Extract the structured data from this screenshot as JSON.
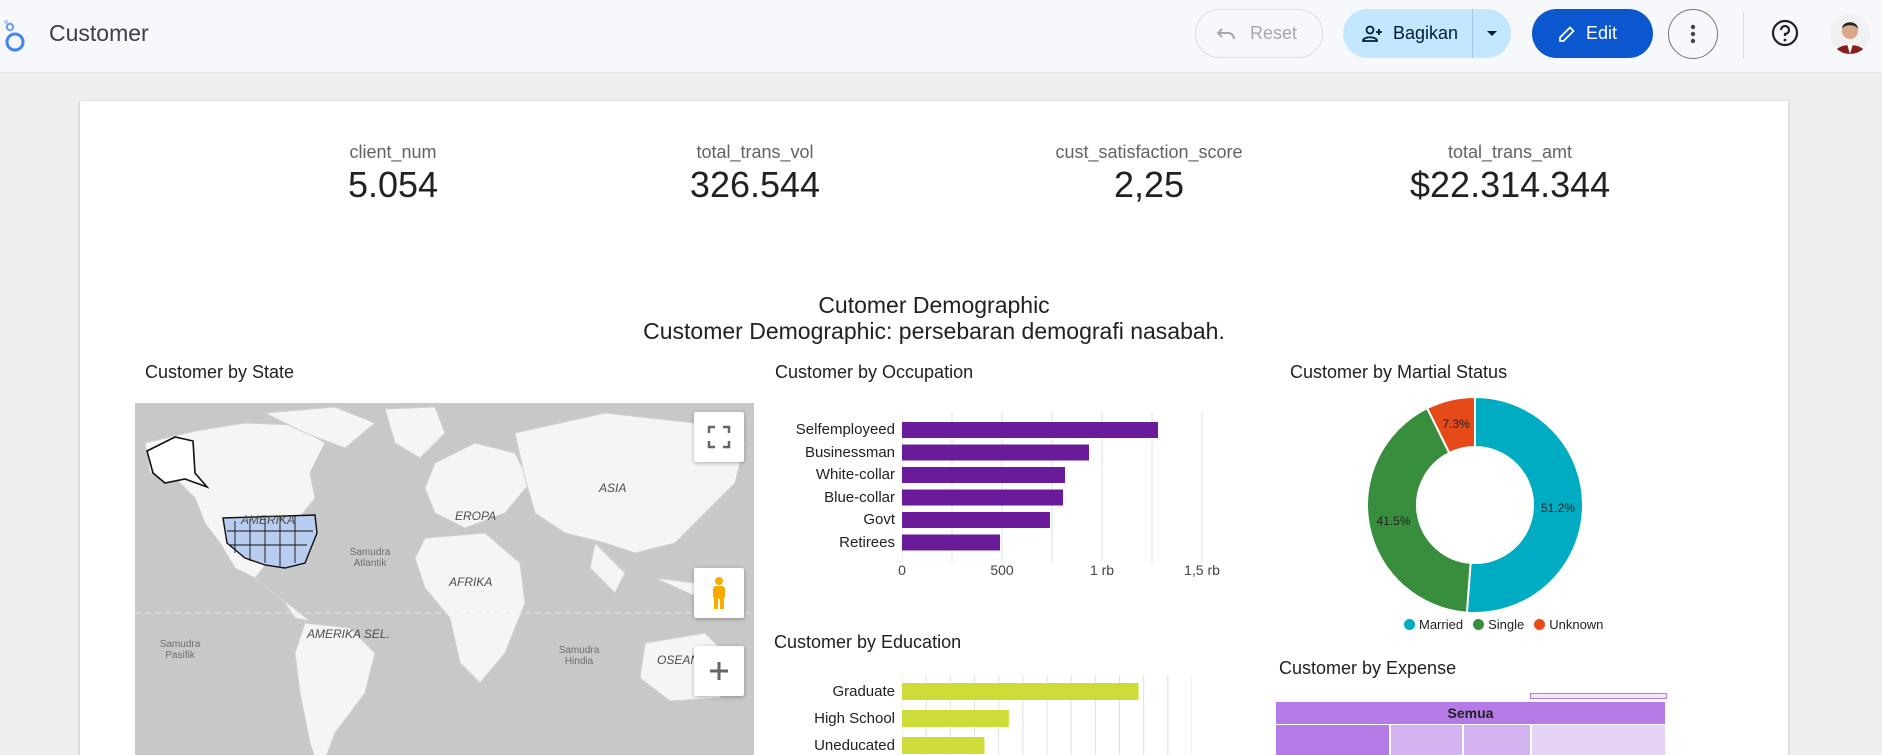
{
  "header": {
    "title": "Customer",
    "reset_label": "Reset",
    "share_label": "Bagikan",
    "edit_label": "Edit"
  },
  "kpis": [
    {
      "label": "client_num",
      "value": "5.054"
    },
    {
      "label": "total_trans_vol",
      "value": "326.544"
    },
    {
      "label": "cust_satisfaction_score",
      "value": "2,25"
    },
    {
      "label": "total_trans_amt",
      "value": "$22.314.344"
    }
  ],
  "section": {
    "title": "Cutomer Demographic",
    "subtitle": "Customer Demographic: persebaran demografi nasabah."
  },
  "map": {
    "title": "Customer by State",
    "labels": {
      "america": "AMERIKA",
      "europe": "EROPA",
      "asia": "ASIA",
      "africa": "AFRIKA",
      "south_america": "AMERIKA SEL.",
      "oceania": "OSEANIA",
      "atlantic": "Samudra Atlantik",
      "pacific": "Samudra Pasifik",
      "indian": "Samudra Hindia"
    }
  },
  "colors": {
    "bar_occupation": "#6a1b9a",
    "bar_education": "#cddc39",
    "married": "#00acc1",
    "single": "#388e3c",
    "unknown": "#e64a19",
    "primary": "#0b57d0"
  },
  "chart_data": [
    {
      "type": "bar",
      "orientation": "horizontal",
      "title": "Customer by Occupation",
      "categories": [
        "Selfemployeed",
        "Businessman",
        "White-collar",
        "Blue-collar",
        "Govt",
        "Retirees"
      ],
      "values": [
        1280,
        935,
        815,
        805,
        740,
        490
      ],
      "xlim": [
        0,
        1500
      ],
      "xticks": [
        "0",
        "500",
        "1 rb",
        "1,5 rb"
      ]
    },
    {
      "type": "pie",
      "title": "Customer by Martial Status",
      "labels": [
        "Married",
        "Single",
        "Unknown"
      ],
      "values": [
        51.2,
        41.5,
        7.3
      ],
      "value_labels": [
        "51.2%",
        "41.5%",
        "7.3%"
      ],
      "legend_position": "bottom"
    },
    {
      "type": "bar",
      "orientation": "horizontal",
      "title": "Customer by Education",
      "categories": [
        "Graduate",
        "High School",
        "Uneducated"
      ],
      "values": [
        1550,
        700,
        540
      ],
      "xlim": [
        0,
        1900
      ]
    },
    {
      "type": "table",
      "title": "Customer by Expense",
      "root_label": "Semua"
    }
  ]
}
